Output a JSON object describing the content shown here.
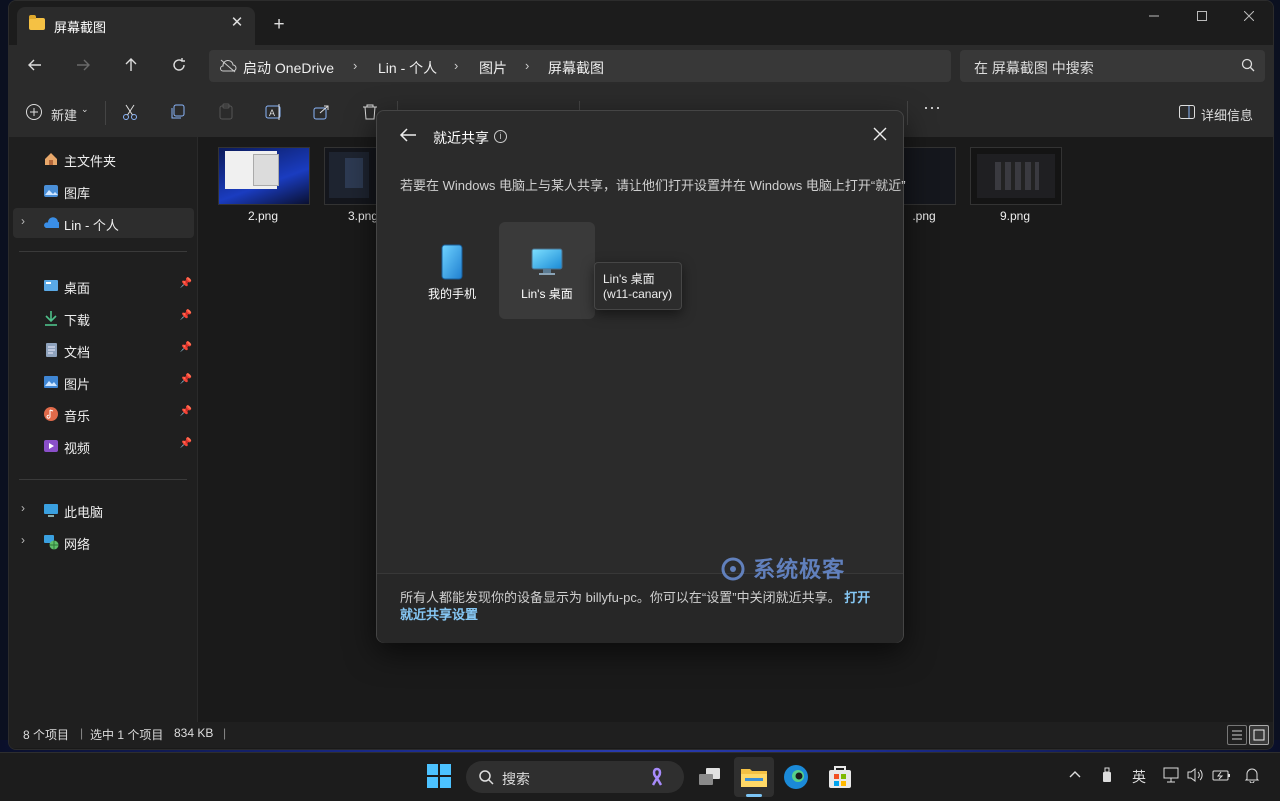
{
  "window": {
    "tab_title": "屏幕截图",
    "close_tab": "✕",
    "new_tab": "+"
  },
  "address": {
    "items": [
      "启动 OneDrive",
      "Lin - 个人",
      "图片",
      "屏幕截图"
    ],
    "search_placeholder": "在 屏幕截图 中搜索"
  },
  "commandbar": {
    "new_label": "新建",
    "more": "···",
    "details_label": "详细信息"
  },
  "navpane": {
    "home": "主文件夹",
    "gallery": "图库",
    "onedrive": "Lin - 个人",
    "quick_access": [
      {
        "label": "桌面",
        "icon": "desktop-icon"
      },
      {
        "label": "下载",
        "icon": "download-icon"
      },
      {
        "label": "文档",
        "icon": "document-icon"
      },
      {
        "label": "图片",
        "icon": "pictures-icon"
      },
      {
        "label": "音乐",
        "icon": "music-icon"
      },
      {
        "label": "视频",
        "icon": "video-icon"
      }
    ],
    "this_pc": "此电脑",
    "network": "网络"
  },
  "files": [
    {
      "name": "2.png"
    },
    {
      "name": "3.png"
    },
    {
      "name": ".png"
    },
    {
      "name": "9.png"
    }
  ],
  "status": {
    "count": "8 个项目",
    "selected": "选中 1 个项目",
    "size": "834 KB"
  },
  "share_dialog": {
    "title": "就近共享",
    "hint": "若要在 Windows 电脑上与某人共享，请让他们打开设置并在 Windows 电脑上打开“就近”",
    "devices": [
      {
        "label": "我的手机"
      },
      {
        "label": "Lin's 桌面"
      }
    ],
    "tooltip_line1": "Lin's 桌面",
    "tooltip_line2": "(w11-canary)",
    "footer_text": "所有人都能发现你的设备显示为 billyfu-pc。你可以在“设置”中关闭就近共享。",
    "footer_link": "打开就近共享设置"
  },
  "watermark": "系统极客",
  "taskbar": {
    "search_label": "搜索",
    "ime": "英"
  },
  "colors": {
    "accent": "#86c8f5",
    "folder": "#f5c144"
  }
}
